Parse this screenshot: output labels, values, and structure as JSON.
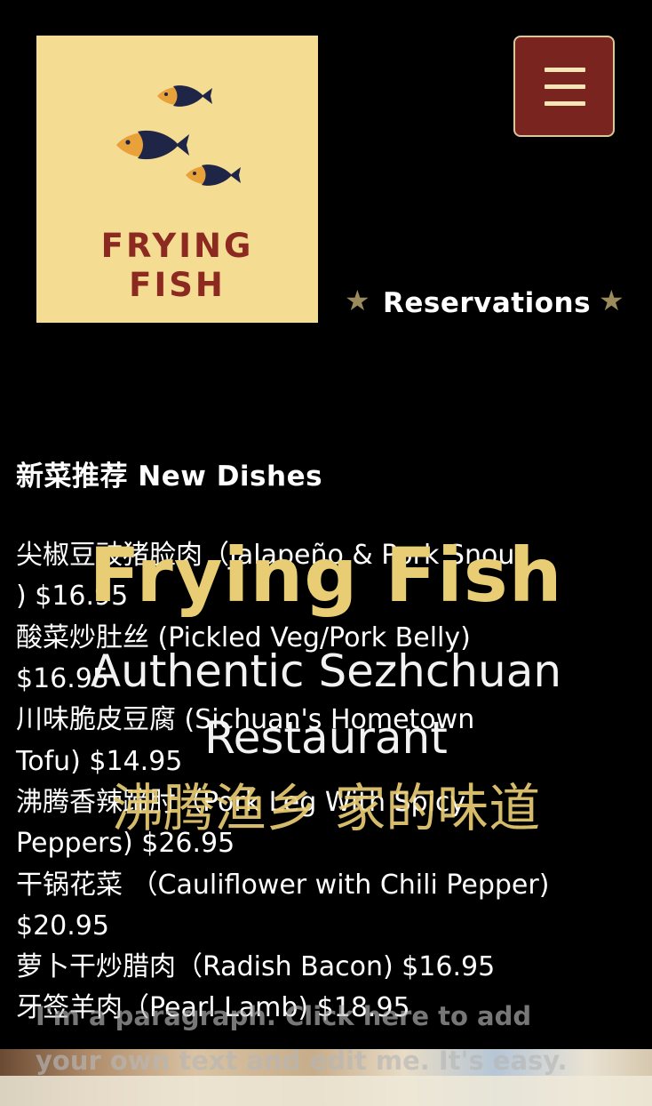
{
  "logo": {
    "line1": "FRYING",
    "line2": "FISH",
    "background_color": "#f4dd92",
    "text_color": "#8c2a22",
    "fish_colors": [
      "#e9a13a",
      "#1f2547"
    ]
  },
  "menu_button": {
    "icon": "hamburger-menu-icon",
    "background_color": "#7a2420"
  },
  "reservations": {
    "label": "Reservations",
    "icon": "star-icon"
  },
  "section": {
    "title": "新菜推荐 New Dishes"
  },
  "dishes": [
    "尖椒豆豉猪脸肉（Jalapeño & Pork Snout",
    ") $16.95",
    "酸菜炒肚丝 (Pickled Veg/Pork Belly)",
    "$16.95",
    "川味脆皮豆腐 (Sichuan's Hometown",
    "Tofu) $14.95",
    "沸腾香辣蹄肘（Pork Leg With Spicy",
    "Peppers) $26.95",
    "干锅花菜 （Cauliflower with Chili Pepper)",
    "$20.95",
    "萝卜干炒腊肉（Radish Bacon) $16.95",
    "牙签羊肉（Pearl Lamb) $18.95"
  ],
  "overlay": {
    "title": "Frying Fish",
    "subtitle_line1": "Authentic Sezhchuan",
    "subtitle_line2": "Restaurant",
    "tagline_cn": "沸腾渔乡  家的味道",
    "title_color": "#e9cd74"
  },
  "paragraph": {
    "line1": "I'm a paragraph. Click here to add",
    "line2": "your own text and edit me. It's easy."
  }
}
